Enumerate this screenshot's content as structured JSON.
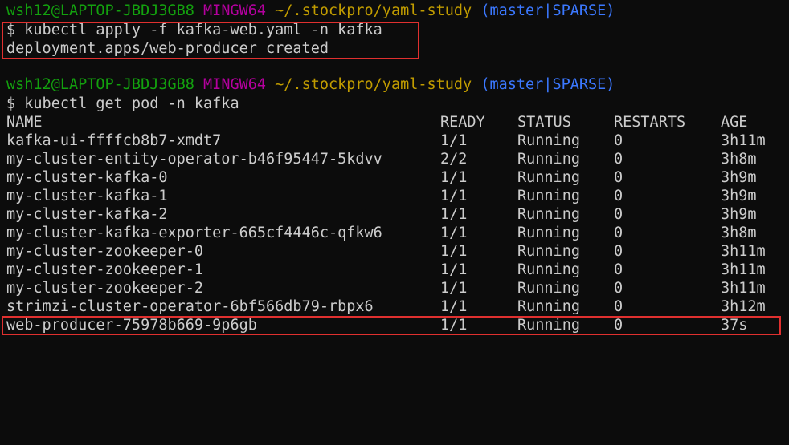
{
  "prompt1": {
    "user_host": "wsh12@LAPTOP-JBDJ3GB8",
    "msystem": "MINGW64",
    "path": "~/.stockpro/yaml-study",
    "branch": "(master|SPARSE)"
  },
  "cmd1": "$ kubectl apply -f kafka-web.yaml -n kafka",
  "cmd1_output": "deployment.apps/web-producer created",
  "prompt2": {
    "user_host": "wsh12@LAPTOP-JBDJ3GB8",
    "msystem": "MINGW64",
    "path": "~/.stockpro/yaml-study",
    "branch": "(master|SPARSE)"
  },
  "cmd2": "$ kubectl get pod -n kafka",
  "table": {
    "headers": {
      "name": "NAME",
      "ready": "READY",
      "status": "STATUS",
      "restarts": "RESTARTS",
      "age": "AGE"
    },
    "rows": [
      {
        "name": "kafka-ui-ffffcb8b7-xmdt7",
        "ready": "1/1",
        "status": "Running",
        "restarts": "0",
        "age": "3h11m"
      },
      {
        "name": "my-cluster-entity-operator-b46f95447-5kdvv",
        "ready": "2/2",
        "status": "Running",
        "restarts": "0",
        "age": "3h8m"
      },
      {
        "name": "my-cluster-kafka-0",
        "ready": "1/1",
        "status": "Running",
        "restarts": "0",
        "age": "3h9m"
      },
      {
        "name": "my-cluster-kafka-1",
        "ready": "1/1",
        "status": "Running",
        "restarts": "0",
        "age": "3h9m"
      },
      {
        "name": "my-cluster-kafka-2",
        "ready": "1/1",
        "status": "Running",
        "restarts": "0",
        "age": "3h9m"
      },
      {
        "name": "my-cluster-kafka-exporter-665cf4446c-qfkw6",
        "ready": "1/1",
        "status": "Running",
        "restarts": "0",
        "age": "3h8m"
      },
      {
        "name": "my-cluster-zookeeper-0",
        "ready": "1/1",
        "status": "Running",
        "restarts": "0",
        "age": "3h11m"
      },
      {
        "name": "my-cluster-zookeeper-1",
        "ready": "1/1",
        "status": "Running",
        "restarts": "0",
        "age": "3h11m"
      },
      {
        "name": "my-cluster-zookeeper-2",
        "ready": "1/1",
        "status": "Running",
        "restarts": "0",
        "age": "3h11m"
      },
      {
        "name": "strimzi-cluster-operator-6bf566db79-rbpx6",
        "ready": "1/1",
        "status": "Running",
        "restarts": "0",
        "age": "3h12m"
      },
      {
        "name": "web-producer-75978b669-9p6gb",
        "ready": "1/1",
        "status": "Running",
        "restarts": "0",
        "age": "37s"
      }
    ]
  },
  "colors": {
    "background": "#0c0c0c",
    "text": "#cccccc",
    "user_host": "#13a10e",
    "msystem": "#b4009e",
    "path": "#c19c00",
    "branch": "#3b78ff",
    "highlight": "#e0302f"
  }
}
